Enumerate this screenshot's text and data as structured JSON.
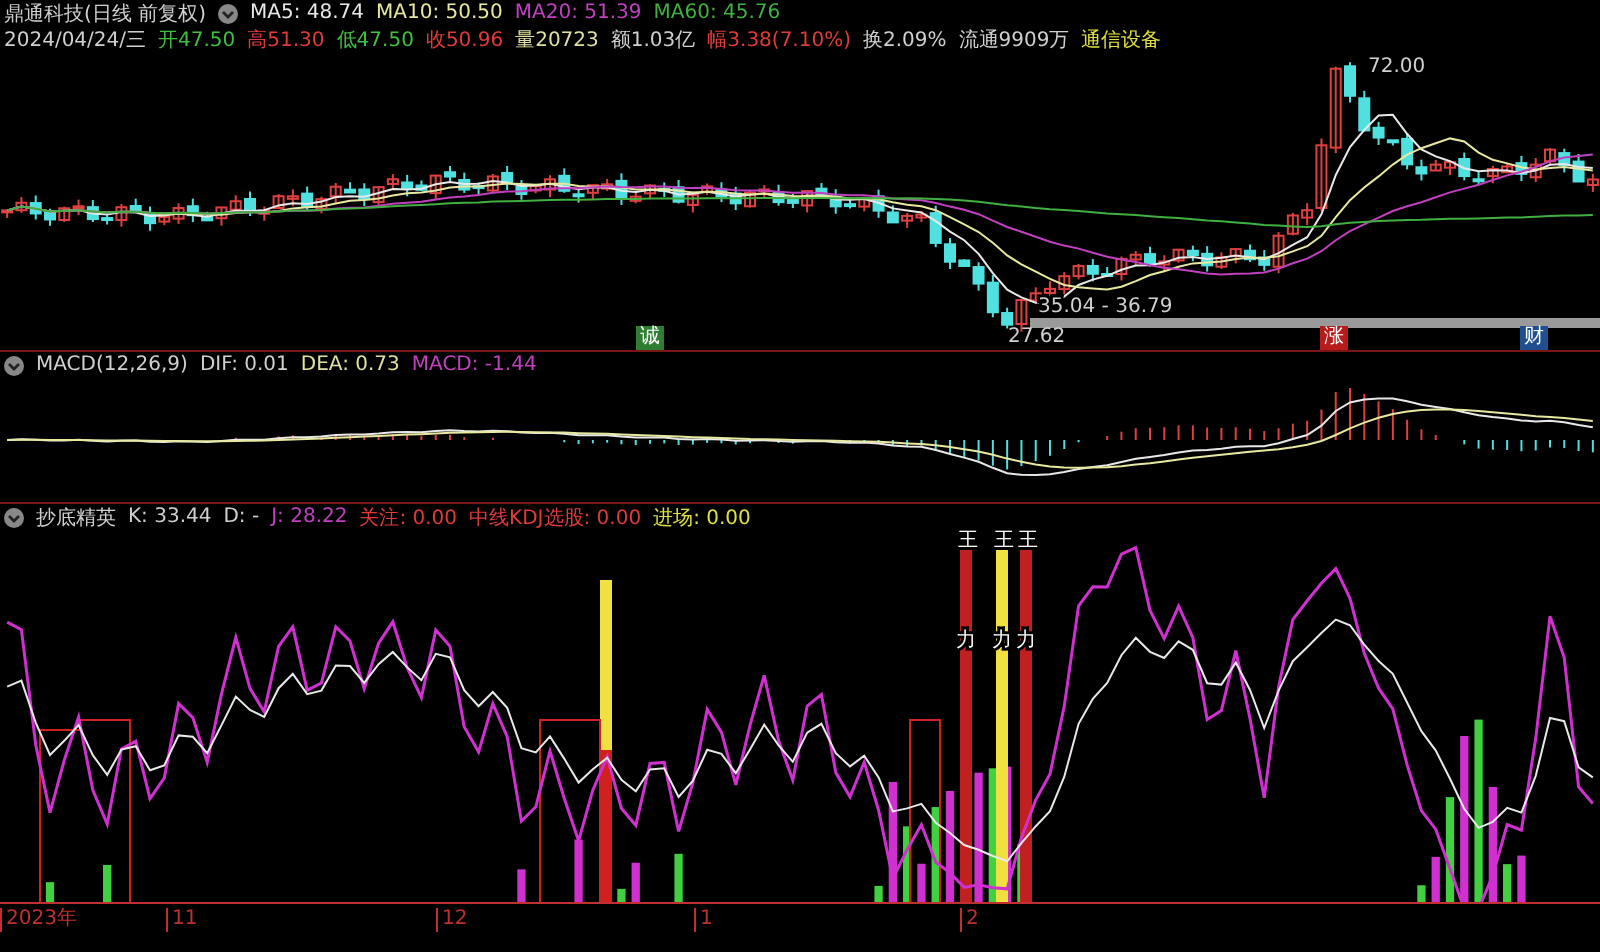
{
  "header": {
    "title": "鼎通科技(日线 前复权)",
    "ma": [
      {
        "text": "MA5: 48.74",
        "color": "#e8e8e8"
      },
      {
        "text": "MA10: 50.50",
        "color": "#e8e8a0"
      },
      {
        "text": "MA20: 51.39",
        "color": "#c040c0"
      },
      {
        "text": "MA60: 45.76",
        "color": "#40b040"
      }
    ],
    "quote": [
      {
        "text": "2024/04/24/三",
        "color": "#d0d0d0"
      },
      {
        "text": "开47.50",
        "color": "#40c040"
      },
      {
        "text": "高51.30",
        "color": "#e03a3a"
      },
      {
        "text": "低47.50",
        "color": "#40c040"
      },
      {
        "text": "收50.96",
        "color": "#e03a3a"
      },
      {
        "text": "量20723",
        "color": "#e0e0a0"
      },
      {
        "text": "额1.03亿",
        "color": "#d0d0d0"
      },
      {
        "text": "幅3.38(7.10%)",
        "color": "#e03a3a"
      },
      {
        "text": "换2.09%",
        "color": "#d0d0d0"
      },
      {
        "text": "流通9909万",
        "color": "#d0d0d0"
      },
      {
        "text": "通信设备",
        "color": "#e0e040"
      }
    ]
  },
  "price_labels": {
    "high": "72.00",
    "low": "27.62",
    "range": "35.04 - 36.79"
  },
  "events": [
    {
      "text": "诚",
      "color": "#2e7d32"
    },
    {
      "text": "涨",
      "color": "#b71c1c"
    },
    {
      "text": "财",
      "color": "#1f4f8f"
    }
  ],
  "macd": {
    "items": [
      {
        "text": "MACD(12,26,9)",
        "color": "#d0d0d0"
      },
      {
        "text": "DIF: 0.01",
        "color": "#d0d0d0"
      },
      {
        "text": "DEA: 0.73",
        "color": "#e0e0a0"
      },
      {
        "text": "MACD: -1.44",
        "color": "#c040c0"
      }
    ]
  },
  "kdj": {
    "items": [
      {
        "text": "抄底精英",
        "color": "#d0d0d0"
      },
      {
        "text": "K: 33.44",
        "color": "#d0d0d0"
      },
      {
        "text": "D: -",
        "color": "#d0d0d0"
      },
      {
        "text": "J: 28.22",
        "color": "#c040c0"
      },
      {
        "text": "关注: 0.00",
        "color": "#e03a3a"
      },
      {
        "text": "中线KDJ选股: 0.00",
        "color": "#e03a3a"
      },
      {
        "text": "进场: 0.00",
        "color": "#e0e040"
      }
    ],
    "bar_marks": [
      {
        "top": "王",
        "mid": "力"
      },
      {
        "top": "王",
        "mid": "力"
      },
      {
        "top": "王",
        "mid": "力"
      }
    ]
  },
  "axis": [
    "2023年",
    "11",
    "12",
    "1",
    "2"
  ]
}
